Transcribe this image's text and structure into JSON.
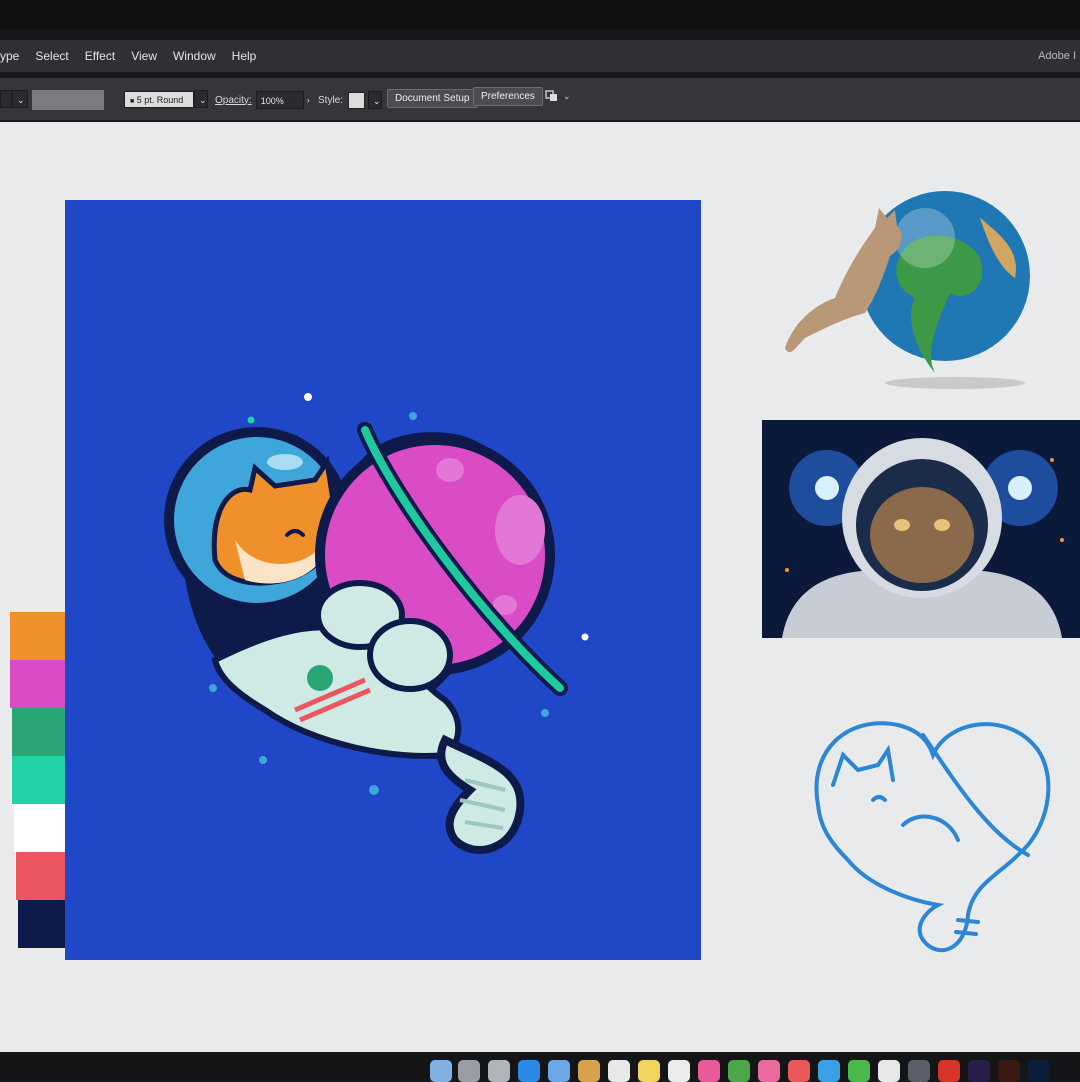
{
  "menubar": {
    "items": [
      "ype",
      "Select",
      "Effect",
      "View",
      "Window",
      "Help"
    ],
    "app_title": "Adobe I"
  },
  "controlbar": {
    "stroke_profile": "5 pt. Round",
    "opacity_label": "Opacity:",
    "opacity_value": "100%",
    "style_label": "Style:",
    "document_setup": "Document Setup",
    "preferences": "Preferences"
  },
  "palette": {
    "swatches": [
      "#f0902a",
      "#d94cc6",
      "#2aa676",
      "#22d2a6",
      "#ffffff",
      "#ec5560",
      "#0e1a4a"
    ]
  },
  "colors": {
    "artboard_bg": "#1f47c8",
    "outline": "#0e1a4a",
    "planet": "#d94cc6",
    "ring": "#1fc9a0",
    "cat_orange": "#f0902a",
    "suit": "#cfe9e4",
    "stripe": "#ec5560",
    "helmet": "#3fa6dc",
    "sketch_blue": "#2b86d6"
  },
  "icons": {
    "arrange_icon": "arrange-icon",
    "dropdown": "chevron-down-icon"
  }
}
